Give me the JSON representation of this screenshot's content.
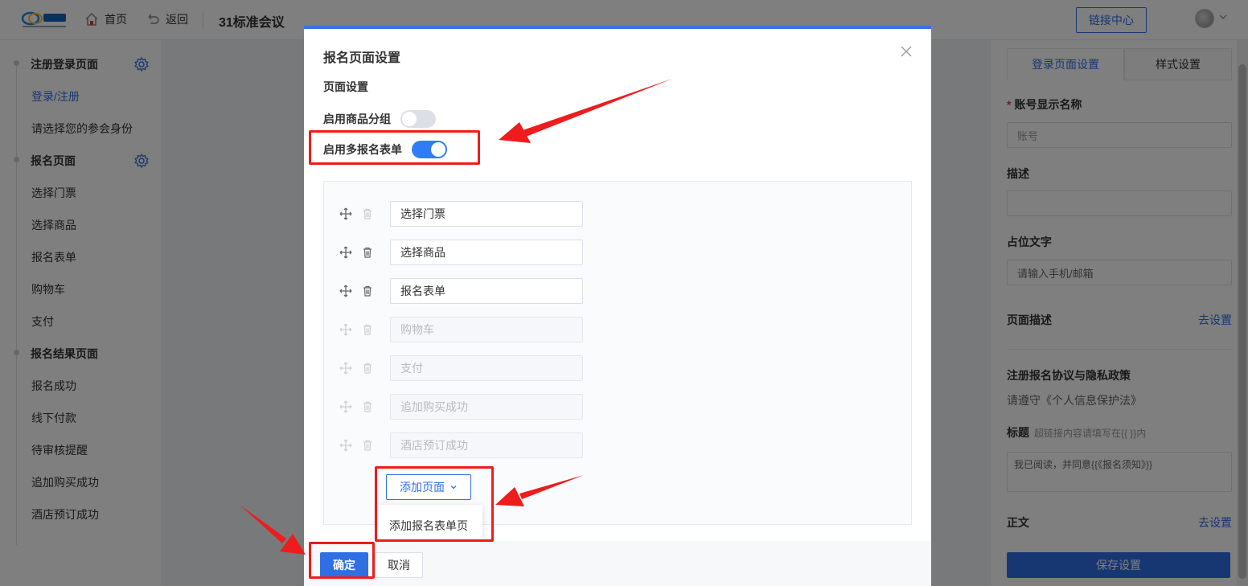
{
  "header": {
    "home_label": "首页",
    "back_label": "返回",
    "title": "31标准会议",
    "link_center_label": "链接中心"
  },
  "sidebar": {
    "groups": [
      {
        "label": "注册登录页面",
        "items": [
          "登录/注册",
          "请选择您的参会身份"
        ]
      },
      {
        "label": "报名页面",
        "items": [
          "选择门票",
          "选择商品",
          "报名表单",
          "购物车",
          "支付"
        ]
      },
      {
        "label": "报名结果页面",
        "items": [
          "报名成功",
          "线下付款",
          "待审核提醒",
          "追加购买成功",
          "酒店预订成功"
        ]
      }
    ]
  },
  "right_panel": {
    "tabs": [
      "登录页面设置",
      "样式设置"
    ],
    "account_label": "账号显示名称",
    "account_value": "账号",
    "desc_label": "描述",
    "desc_value": "",
    "placeholder_label": "占位文字",
    "placeholder_value": "请输入手机/邮箱",
    "page_desc_label": "页面描述",
    "page_desc_link": "去设置",
    "agreement_label": "注册报名协议与隐私政策",
    "agreement_text": "请遵守《个人信息保护法》",
    "title_label": "标题",
    "title_hint": "超链接内容请填写在{{ }}内",
    "title_value": "我已阅读，并同意{{《报名须知》}}",
    "body_label": "正文",
    "body_link": "去设置",
    "save_label": "保存设置"
  },
  "modal": {
    "title": "报名页面设置",
    "section_title": "页面设置",
    "toggle_group_label": "启用商品分组",
    "toggle_group_on": false,
    "toggle_multi_label": "启用多报名表单",
    "toggle_multi_on": true,
    "pages": [
      {
        "name": "选择门票",
        "enabled": true
      },
      {
        "name": "选择商品",
        "enabled": true
      },
      {
        "name": "报名表单",
        "enabled": true
      },
      {
        "name": "购物车",
        "enabled": false
      },
      {
        "name": "支付",
        "enabled": false
      },
      {
        "name": "追加购买成功",
        "enabled": false
      },
      {
        "name": "酒店预订成功",
        "enabled": false
      }
    ],
    "add_page_label": "添加页面",
    "dropdown_item": "添加报名表单页",
    "confirm_label": "确定",
    "cancel_label": "取消"
  },
  "colors": {
    "accent": "#2f6fe4",
    "highlight": "#ee1c1c"
  }
}
